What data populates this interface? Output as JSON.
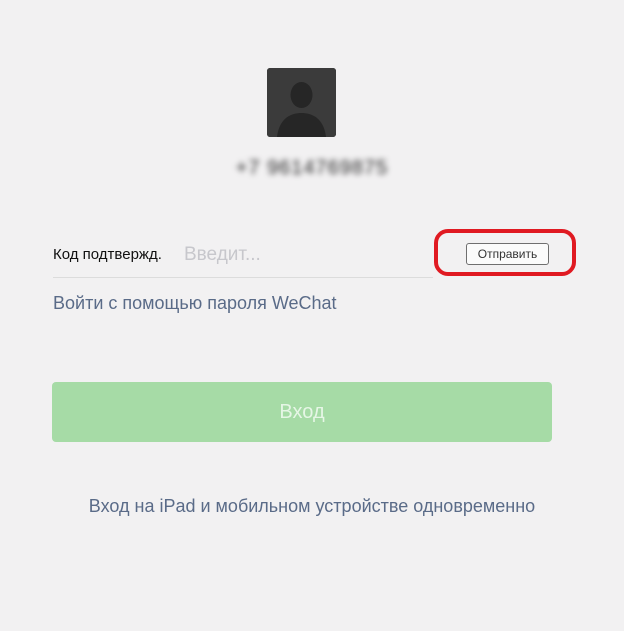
{
  "account": {
    "phone_masked": "+7 9614769875"
  },
  "verification": {
    "label": "Код подтвержд.",
    "input_placeholder": "Введит...",
    "input_value": "",
    "send_button_label": "Отправить"
  },
  "links": {
    "wechat_password_login": "Войти с помощью пароля WeChat",
    "ipad_mobile_login": "Вход на iPad и мобильном устройстве одновременно"
  },
  "login_button_label": "Вход",
  "colors": {
    "background": "#f2f1f2",
    "login_button_disabled": "#a6dba6",
    "link": "#5a6b88",
    "highlight_ring": "#e01a22"
  },
  "icons": {
    "avatar": "default-user-silhouette-icon"
  }
}
